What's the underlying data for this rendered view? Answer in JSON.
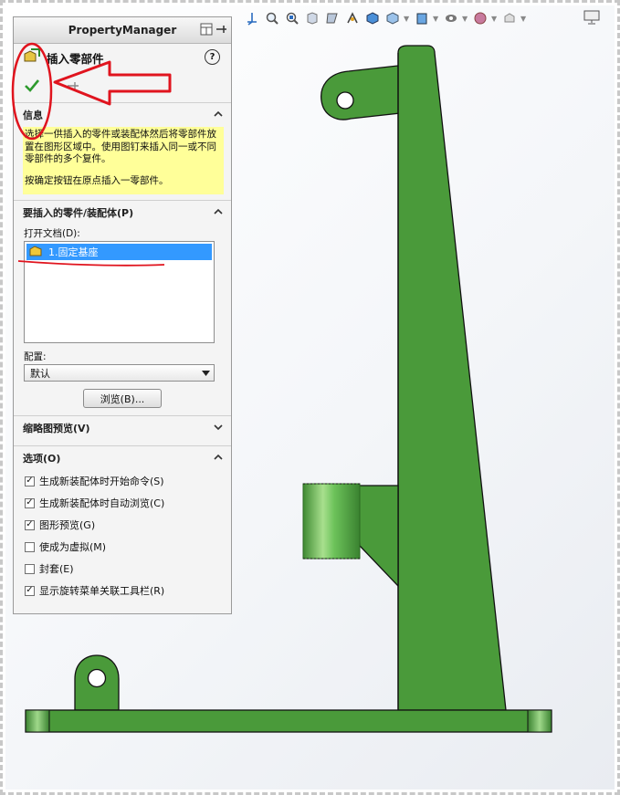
{
  "property_manager": {
    "title": "PropertyManager",
    "feature_title": "插入零部件",
    "help_label": "?",
    "sections": {
      "info": {
        "header": "信息",
        "paragraph1": "选择一供插入的零件或装配体然后将零部件放置在图形区域中。使用图钉来插入同一或不同零部件的多个复件。",
        "paragraph2": "按确定按钮在原点插入一零部件。"
      },
      "part": {
        "header": "要插入的零件/装配体(P)",
        "open_docs_label": "打开文档(D):",
        "documents": [
          "1.固定基座"
        ],
        "config_label": "配置:",
        "config_value": "默认",
        "browse_label": "浏览(B)..."
      },
      "thumbnail": {
        "header": "缩略图预览(V)"
      },
      "options": {
        "header": "选项(O)",
        "items": [
          {
            "label": "生成新装配体时开始命令(S)",
            "checked": true
          },
          {
            "label": "生成新装配体时自动浏览(C)",
            "checked": true
          },
          {
            "label": "图形预览(G)",
            "checked": true
          },
          {
            "label": "使成为虚拟(M)",
            "checked": false
          },
          {
            "label": "封套(E)",
            "checked": false
          },
          {
            "label": "显示旋转菜单关联工具栏(R)",
            "checked": true
          }
        ]
      }
    }
  },
  "colors": {
    "part_green": "#4a9a3a",
    "highlight": "#3399ff",
    "info_bg": "#ffff99",
    "annotation_red": "#e0141e"
  },
  "heads_up_toolbar": [
    "view-orientation-icon",
    "zoom-to-fit-icon",
    "zoom-to-area-icon",
    "previous-view-icon",
    "section-view-icon",
    "dynamic-annotation-icon",
    "view-orientation-cube-icon",
    "display-style-icon",
    "hide-show-items-icon",
    "edit-appearance-icon",
    "apply-scene-icon",
    "view-settings-icon"
  ]
}
